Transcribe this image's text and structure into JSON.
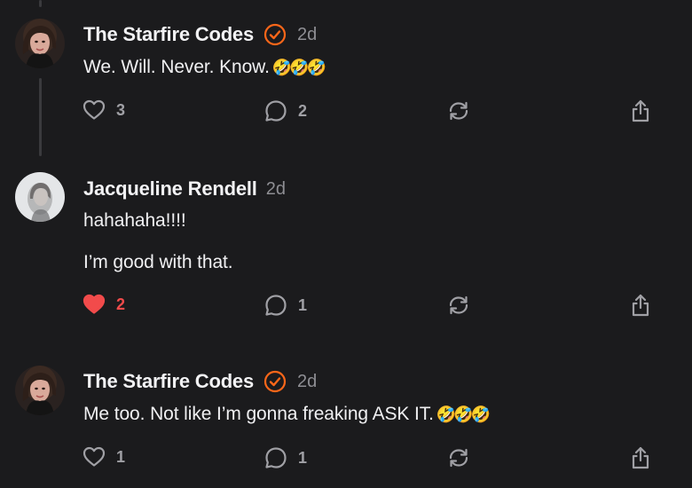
{
  "posts": [
    {
      "author": "The Starfire Codes",
      "verified": true,
      "time": "2d",
      "lines": [
        "We. Will. Never. Know."
      ],
      "emoji": "🤣🤣🤣",
      "likes": "3",
      "liked": false,
      "comments": "2"
    },
    {
      "author": "Jacqueline Rendell",
      "verified": false,
      "time": "2d",
      "lines": [
        "hahahaha!!!!",
        "I’m good with that."
      ],
      "likes": "2",
      "liked": true,
      "comments": "1"
    },
    {
      "author": "The Starfire Codes",
      "verified": true,
      "time": "2d",
      "lines": [
        "Me too. Not like I’m gonna freaking ASK IT."
      ],
      "emoji": "🤣🤣🤣",
      "likes": "1",
      "liked": false,
      "comments": "1"
    }
  ],
  "icons": {
    "like": "heart-icon",
    "comment": "speech-bubble-icon",
    "restack": "restack-arrows-icon",
    "share": "share-upload-icon",
    "verified": "verified-check-badge-icon"
  },
  "colors": {
    "background": "#1b1b1d",
    "verified_badge": "#ff6719",
    "liked_heart": "#f24b4b",
    "icon_gray": "#a0a0a5"
  }
}
